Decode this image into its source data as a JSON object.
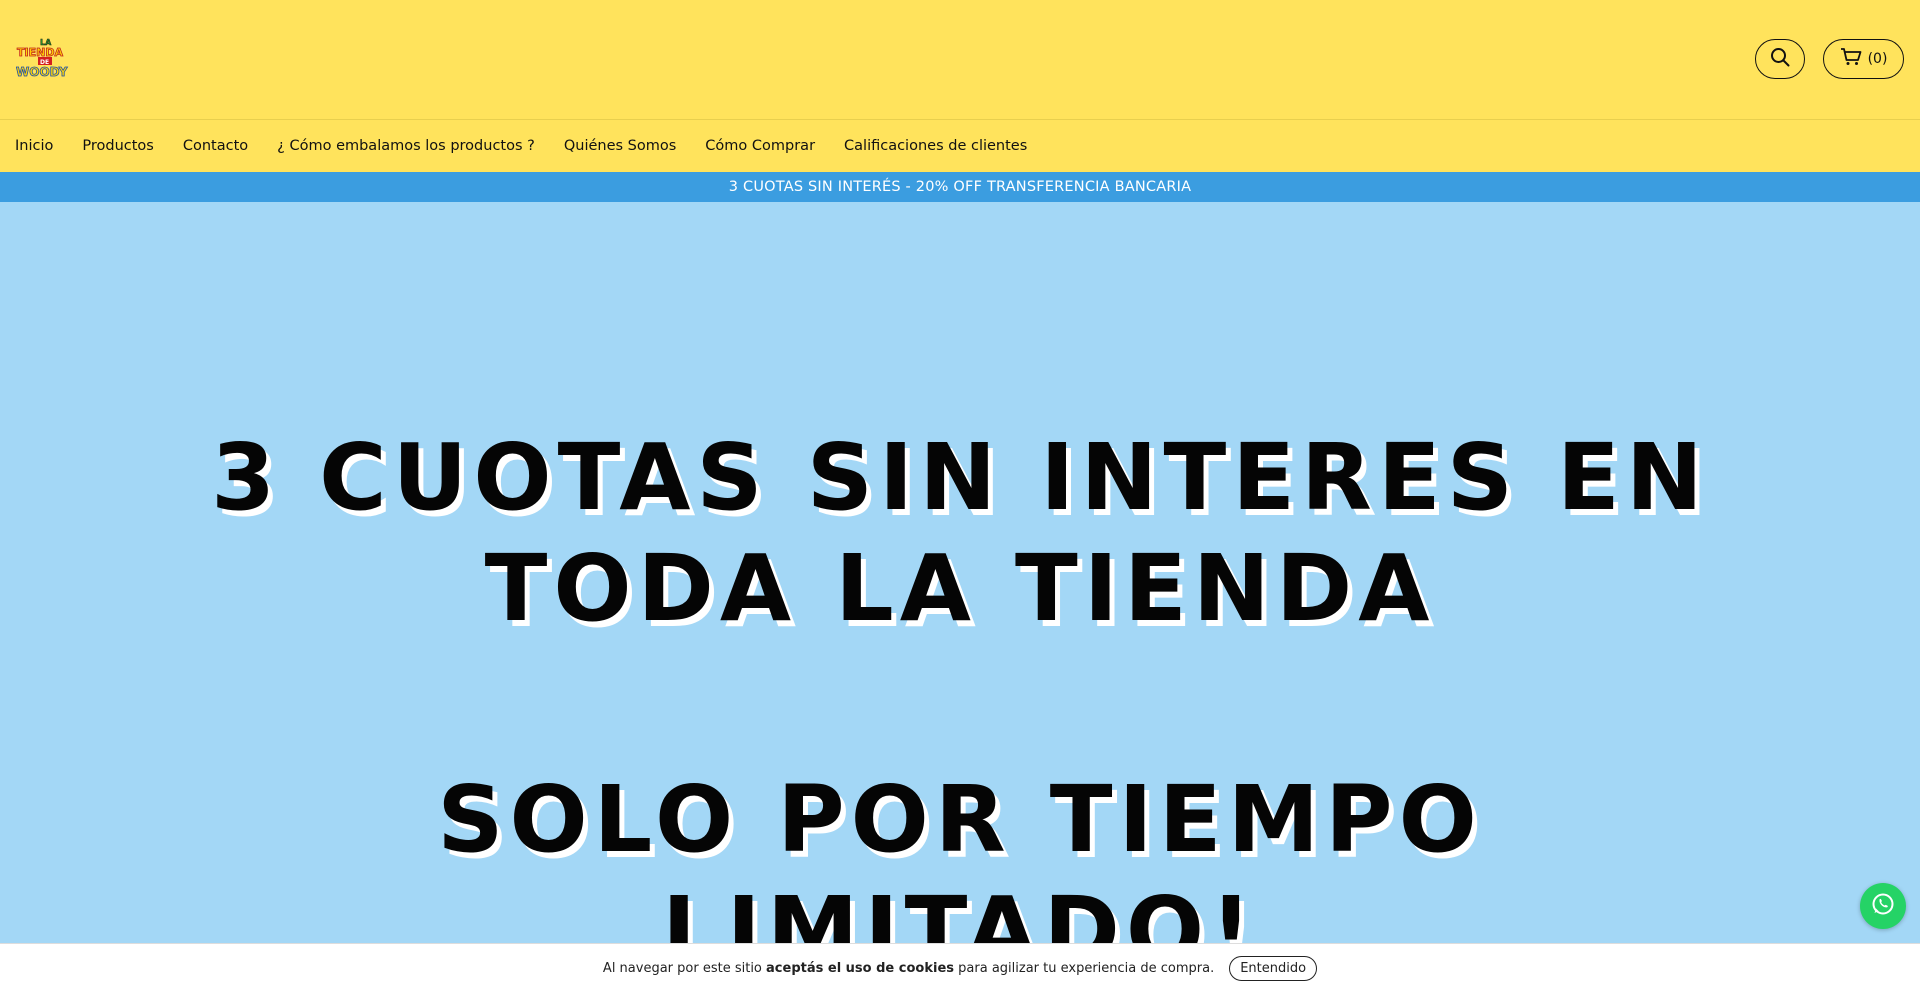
{
  "header": {
    "logo_text": "LA TIENDA DE WOODY",
    "cart_count": "(0)",
    "search_icon": "search-icon",
    "cart_icon": "cart-icon"
  },
  "nav": {
    "items": [
      "Inicio",
      "Productos",
      "Contacto",
      "¿ Cómo embalamos los productos ?",
      "Quiénes Somos",
      "Cómo Comprar",
      "Calificaciones de clientes"
    ]
  },
  "promo_bar": {
    "text": "3 CUOTAS SIN INTERÉS - 20% OFF TRANSFERENCIA BANCARIA"
  },
  "hero": {
    "line1": "3 CUOTAS SIN INTERES EN",
    "line2": "TODA LA TIENDA",
    "line3": "SOLO POR TIEMPO",
    "line4": "LIMITADO!"
  },
  "cookie": {
    "text_before": "Al navegar por este sitio",
    "text_bold": "aceptás el uso de cookies",
    "text_after": "para agilizar tu experiencia de compra.",
    "button": "Entendido"
  },
  "colors": {
    "header_bg": "#ffe35c",
    "promo_bg": "#3b9de0",
    "hero_bg": "#a3d7f6",
    "whatsapp": "#25d366"
  }
}
